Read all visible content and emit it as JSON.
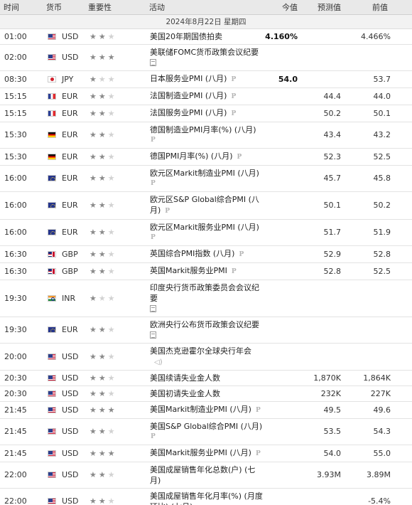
{
  "header": {
    "time": "时间",
    "currency": "货币",
    "importance": "重要性",
    "event": "活动",
    "actual": "今值",
    "forecast": "预测值",
    "previous": "前值"
  },
  "date_label": "2024年8月22日 星期四",
  "icons": {
    "star": "star-icon",
    "preliminary_badge": "P",
    "document": "document-icon",
    "speech": "speaker-icon"
  },
  "colors": {
    "header_bg": "#e9e9e9",
    "star_on": "#8a8a8a",
    "star_off": "#d2d2d2"
  },
  "events": [
    {
      "time": "01:00",
      "flag": "us",
      "currency": "USD",
      "stars": 2,
      "name": "美国20年期国债拍卖",
      "badge": "",
      "icon": "",
      "actual": "4.160%",
      "forecast": "",
      "previous": "4.466%"
    },
    {
      "time": "02:00",
      "flag": "us",
      "currency": "USD",
      "stars": 3,
      "name": "美联储FOMC货币政策会议纪要",
      "badge": "",
      "icon": "doc",
      "actual": "",
      "forecast": "",
      "previous": ""
    },
    {
      "time": "08:30",
      "flag": "jp",
      "currency": "JPY",
      "stars": 1,
      "name": "日本服务业PMI (八月)",
      "badge": "P",
      "icon": "",
      "actual": "54.0",
      "forecast": "",
      "previous": "53.7"
    },
    {
      "time": "15:15",
      "flag": "fr",
      "currency": "EUR",
      "stars": 2,
      "name": "法国制造业PMI (八月)",
      "badge": "P",
      "icon": "",
      "actual": "",
      "forecast": "44.4",
      "previous": "44.0"
    },
    {
      "time": "15:15",
      "flag": "fr",
      "currency": "EUR",
      "stars": 2,
      "name": "法国服务业PMI (八月)",
      "badge": "P",
      "icon": "",
      "actual": "",
      "forecast": "50.2",
      "previous": "50.1"
    },
    {
      "time": "15:30",
      "flag": "de",
      "currency": "EUR",
      "stars": 2,
      "name": "德国制造业PMI月率(%) (八月)",
      "badge": "P",
      "badge_block": true,
      "icon": "",
      "actual": "",
      "forecast": "43.4",
      "previous": "43.2"
    },
    {
      "time": "15:30",
      "flag": "de",
      "currency": "EUR",
      "stars": 2,
      "name": "德国PMI月率(%) (八月)",
      "badge": "P",
      "icon": "",
      "actual": "",
      "forecast": "52.3",
      "previous": "52.5"
    },
    {
      "time": "16:00",
      "flag": "eu",
      "currency": "EUR",
      "stars": 2,
      "name": "欧元区Markit制造业PMI (八月)",
      "badge": "P",
      "badge_block": true,
      "icon": "",
      "actual": "",
      "forecast": "45.7",
      "previous": "45.8"
    },
    {
      "time": "16:00",
      "flag": "eu",
      "currency": "EUR",
      "stars": 2,
      "name": "欧元区S&P Global综合PMI (八月)",
      "badge": "P",
      "icon": "",
      "actual": "",
      "forecast": "50.1",
      "previous": "50.2"
    },
    {
      "time": "16:00",
      "flag": "eu",
      "currency": "EUR",
      "stars": 2,
      "name": "欧元区Markit服务业PMI (八月)",
      "badge": "P",
      "badge_block": true,
      "icon": "",
      "actual": "",
      "forecast": "51.7",
      "previous": "51.9"
    },
    {
      "time": "16:30",
      "flag": "gb",
      "currency": "GBP",
      "stars": 2,
      "name": "英国综合PMI指数 (八月)",
      "badge": "P",
      "icon": "",
      "actual": "",
      "forecast": "52.9",
      "previous": "52.8"
    },
    {
      "time": "16:30",
      "flag": "gb",
      "currency": "GBP",
      "stars": 2,
      "name": "英国Markit服务业PMI",
      "badge": "P",
      "icon": "",
      "actual": "",
      "forecast": "52.8",
      "previous": "52.5"
    },
    {
      "time": "19:30",
      "flag": "in",
      "currency": "INR",
      "stars": 1,
      "name": "印度央行货币政策委员会会议纪要",
      "badge": "",
      "icon": "doc",
      "actual": "",
      "forecast": "",
      "previous": ""
    },
    {
      "time": "19:30",
      "flag": "eu",
      "currency": "EUR",
      "stars": 2,
      "name": "欧洲央行公布货币政策会议纪要",
      "badge": "",
      "icon": "doc",
      "actual": "",
      "forecast": "",
      "previous": ""
    },
    {
      "time": "20:00",
      "flag": "us",
      "currency": "USD",
      "stars": 2,
      "name": "美国杰克逊霍尔全球央行年会",
      "badge": "",
      "icon": "speech",
      "actual": "",
      "forecast": "",
      "previous": ""
    },
    {
      "time": "20:30",
      "flag": "us",
      "currency": "USD",
      "stars": 2,
      "name": "美国续请失业金人数",
      "badge": "",
      "icon": "",
      "actual": "",
      "forecast": "1,870K",
      "previous": "1,864K"
    },
    {
      "time": "20:30",
      "flag": "us",
      "currency": "USD",
      "stars": 2,
      "name": "美国初请失业金人数",
      "badge": "",
      "icon": "",
      "actual": "",
      "forecast": "232K",
      "previous": "227K"
    },
    {
      "time": "21:45",
      "flag": "us",
      "currency": "USD",
      "stars": 3,
      "name": "美国Markit制造业PMI (八月)",
      "badge": "P",
      "icon": "",
      "actual": "",
      "forecast": "49.5",
      "previous": "49.6"
    },
    {
      "time": "21:45",
      "flag": "us",
      "currency": "USD",
      "stars": 2,
      "name": "美国S&P Global综合PMI (八月)",
      "badge": "P",
      "badge_block": true,
      "icon": "",
      "actual": "",
      "forecast": "53.5",
      "previous": "54.3"
    },
    {
      "time": "21:45",
      "flag": "us",
      "currency": "USD",
      "stars": 3,
      "name": "美国Markit服务业PMI (八月)",
      "badge": "P",
      "icon": "",
      "actual": "",
      "forecast": "54.0",
      "previous": "55.0"
    },
    {
      "time": "22:00",
      "flag": "us",
      "currency": "USD",
      "stars": 2,
      "name": "美国成屋销售年化总数(户) (七月)",
      "badge": "",
      "icon": "",
      "actual": "",
      "forecast": "3.93M",
      "previous": "3.89M"
    },
    {
      "time": "22:00",
      "flag": "us",
      "currency": "USD",
      "stars": 2,
      "name": "美国成屋销售年化月率(%) (月度环比) (七月)",
      "badge": "",
      "icon": "",
      "actual": "",
      "forecast": "",
      "previous": "-5.4%"
    }
  ]
}
